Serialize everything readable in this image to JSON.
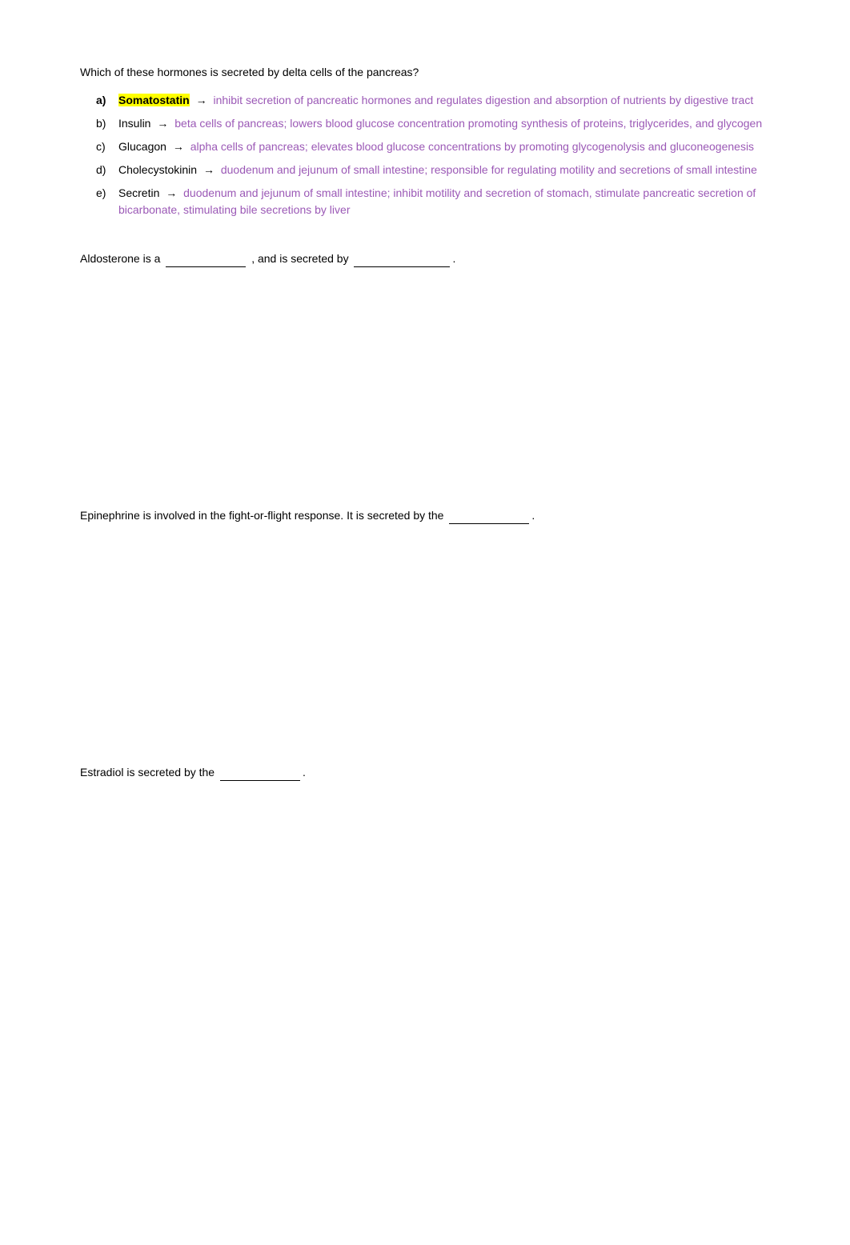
{
  "page": {
    "question1": {
      "text": "Which of these hormones is secreted by delta cells of the pancreas?",
      "options": [
        {
          "label": "a)",
          "key": "Somatostatin",
          "highlighted": true,
          "detail": "inhibit secretion of pancreatic hormones and regulates digestion and absorption of nutrients by digestive tract"
        },
        {
          "label": "b)",
          "key": "Insulin",
          "highlighted": false,
          "detail": "beta cells of pancreas; lowers blood glucose concentration promoting synthesis of proteins, triglycerides, and glycogen"
        },
        {
          "label": "c)",
          "key": "Glucagon",
          "highlighted": false,
          "detail": "alpha cells of pancreas; elevates blood glucose concentrations by promoting glycogenolysis and gluconeogenesis"
        },
        {
          "label": "d)",
          "key": "Cholecystokinin",
          "highlighted": false,
          "detail": "duodenum and jejunum of small intestine; responsible for regulating motility and secretions of small intestine"
        },
        {
          "label": "e)",
          "key": "Secretin",
          "highlighted": false,
          "detail": "duodenum and jejunum of small intestine; inhibit motility and secretion of stomach, stimulate pancreatic secretion of bicarbonate, stimulating bile secretions by liver"
        }
      ]
    },
    "question2": {
      "prefix": "Aldosterone is a",
      "blank1_width": "100",
      "middle": ", and is secreted by",
      "blank2_width": "120"
    },
    "question3": {
      "prefix": "Epinephrine is involved in the fight-or-flight response. It is secreted by the",
      "blank_width": "100"
    },
    "question4": {
      "prefix": "Estradiol is secreted by the",
      "blank_width": "100"
    }
  }
}
